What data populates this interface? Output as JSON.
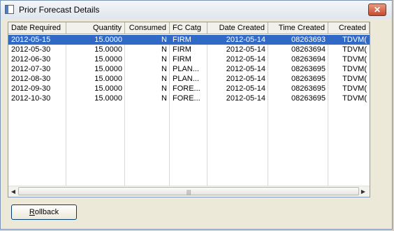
{
  "window": {
    "title": "Prior Forecast Details",
    "close_glyph": "✕"
  },
  "grid": {
    "columns": [
      "Date Required",
      "Quantity",
      "Consumed",
      "FC Catg",
      "Date Created",
      "Time Created",
      "Created"
    ],
    "rows": [
      [
        "2012-05-15",
        "15.0000",
        "N",
        "FIRM",
        "2012-05-14",
        "08263693",
        "TDVM("
      ],
      [
        "2012-05-30",
        "15.0000",
        "N",
        "FIRM",
        "2012-05-14",
        "08263694",
        "TDVM("
      ],
      [
        "2012-06-30",
        "15.0000",
        "N",
        "FIRM",
        "2012-05-14",
        "08263694",
        "TDVM("
      ],
      [
        "2012-07-30",
        "15.0000",
        "N",
        "PLAN...",
        "2012-05-14",
        "08263695",
        "TDVM("
      ],
      [
        "2012-08-30",
        "15.0000",
        "N",
        "PLAN...",
        "2012-05-14",
        "08263695",
        "TDVM("
      ],
      [
        "2012-09-30",
        "15.0000",
        "N",
        "FORE...",
        "2012-05-14",
        "08263695",
        "TDVM("
      ],
      [
        "2012-10-30",
        "15.0000",
        "N",
        "FORE...",
        "2012-05-14",
        "08263695",
        "TDVM("
      ]
    ],
    "selected_row": 0
  },
  "scrollbar": {
    "left_arrow": "◀",
    "right_arrow": "▶",
    "grip": "|||"
  },
  "buttons": {
    "rollback_first": "R",
    "rollback_rest": "ollback"
  }
}
